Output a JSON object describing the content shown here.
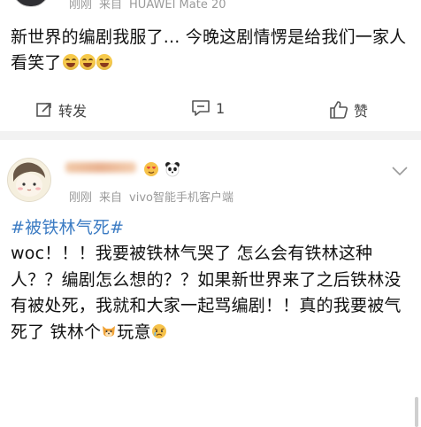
{
  "post1": {
    "meta": {
      "time": "刚刚",
      "source_prefix": "来自",
      "source": "HUAWEI Mate 20"
    },
    "text": "新世界的编剧我服了... 今晚这剧情愣是给我们一家人看笑了",
    "emoji_count": 3,
    "actions": {
      "repost_label": "转发",
      "comment_count": "1",
      "like_label": "赞"
    }
  },
  "post2": {
    "meta": {
      "time": "刚刚",
      "source_prefix": "来自",
      "source": "vivo智能手机客户端"
    },
    "topic": "#被铁林气死#",
    "text_part1": "woc！！！我要被铁林气哭了 怎么会有铁林这种人？？编剧怎么想的？？如果新世界来了之后铁林没有被处死，我就和大家一起骂编剧！！真的我要被气死了 铁林个",
    "text_part2": "玩意"
  },
  "colors": {
    "link": "#3b7bc3",
    "meta": "#9a9a9a",
    "divider": "#f2f2f2"
  }
}
